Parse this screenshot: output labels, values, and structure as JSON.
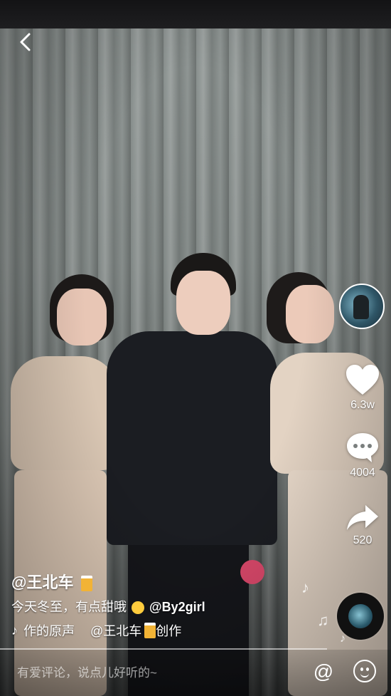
{
  "video": {
    "author_handle": "@王北车",
    "caption_text": "今天冬至，有点甜哦",
    "caption_mention": "@By2girl",
    "music_prefix": "作的原声",
    "music_author": "@王北车",
    "music_suffix": "创作"
  },
  "actions": {
    "like_count": "6.3w",
    "comment_count": "4004",
    "share_count": "520"
  },
  "comment_bar": {
    "placeholder": "有爱评论，说点儿好听的~",
    "at_label": "@"
  },
  "icons": {
    "back": "chevron-left-icon",
    "like": "heart-icon",
    "comment": "speech-bubble-icon",
    "share": "share-arrow-icon",
    "music": "music-note-icon",
    "emoji": "smiley-icon"
  },
  "colors": {
    "text": "#ffffff",
    "background": "#1b1b1d"
  }
}
